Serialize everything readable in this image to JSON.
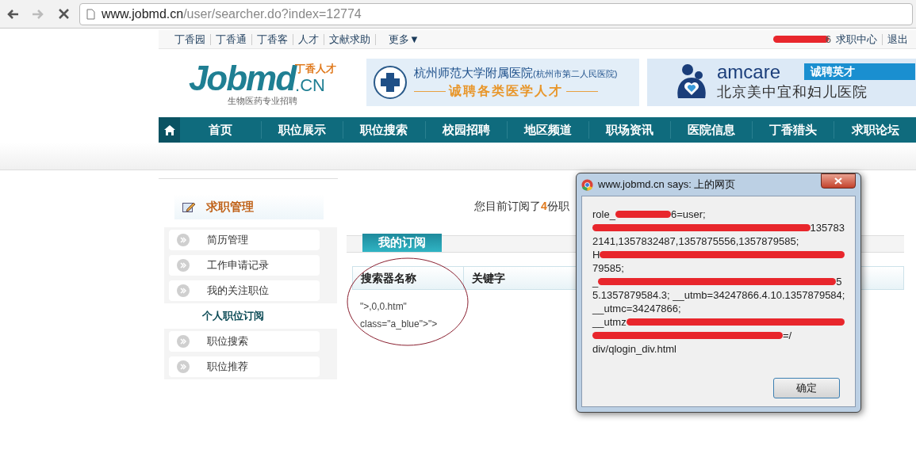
{
  "browser": {
    "back_disabled": false,
    "forward_disabled": true,
    "url_host": "www.jobmd.cn",
    "url_path": "/user/searcher.do?index=12774"
  },
  "top_links": [
    "丁香园",
    "丁香通",
    "丁香客",
    "人才",
    "文献求助"
  ],
  "more": "更多▼",
  "account": {
    "user_tail": "6",
    "links": [
      "求职中心",
      "退出"
    ]
  },
  "logo": {
    "name": "Jobmd",
    "tld": ".CN",
    "cn_name": "丁香人才",
    "slogan": "生物医药专业招聘"
  },
  "banners": [
    {
      "kind": "hospital",
      "title": "杭州师范大学附属医院",
      "subtitle": "(杭州市第二人民医院)",
      "tagline": "诚聘各类医学人才"
    },
    {
      "kind": "amcare",
      "brand": "amcare",
      "badge": "诚聘英才",
      "title": "北京美中宜和妇儿医院"
    }
  ],
  "nav": [
    {
      "label": "首页",
      "selected": false
    },
    {
      "label": "职位展示",
      "selected": false
    },
    {
      "label": "职位搜索",
      "selected": false
    },
    {
      "label": "校园招聘",
      "selected": false
    },
    {
      "label": "地区频道",
      "selected": false
    },
    {
      "label": "职场资讯",
      "selected": false
    },
    {
      "label": "医院信息",
      "selected": false
    },
    {
      "label": "丁香猎头",
      "selected": false
    },
    {
      "label": "求职论坛",
      "selected": false
    }
  ],
  "home_selected": true,
  "sidebar": {
    "title": "求职管理",
    "items": [
      {
        "label": "简历管理",
        "selected": false
      },
      {
        "label": "工作申请记录",
        "selected": false
      },
      {
        "label": "我的关注职位",
        "selected": false
      },
      {
        "label": "个人职位订阅",
        "selected": true
      },
      {
        "label": "职位搜索",
        "selected": false
      },
      {
        "label": "职位推荐",
        "selected": false
      }
    ]
  },
  "summary": {
    "prefix": "您目前订阅了",
    "count": "4",
    "suffix": "份职"
  },
  "tab": "我的订阅",
  "table": {
    "columns": [
      "搜索器名称",
      "关键字"
    ],
    "rows": [
      [
        "\">,0,0.htm\" class=\"a_blue\">\">"
      ]
    ]
  },
  "dialog": {
    "title": "www.jobmd.cn says: 上的网页",
    "lines": [
      [
        {
          "kind": "text",
          "text": "role_"
        },
        {
          "kind": "redaction"
        },
        {
          "kind": "text",
          "text": "6=user;"
        }
      ],
      [
        {
          "kind": "redaction"
        },
        {
          "kind": "text",
          "text": "135783"
        }
      ],
      [
        {
          "kind": "text",
          "text": "2141,1357832487,1357875556,1357879585;"
        }
      ],
      [
        {
          "kind": "text",
          "text": "H"
        },
        {
          "kind": "redaction"
        }
      ],
      [
        {
          "kind": "text",
          "text": "79585;"
        }
      ],
      [
        {
          "kind": "text",
          "text": "_"
        },
        {
          "kind": "redaction"
        },
        {
          "kind": "text",
          "text": "5"
        }
      ],
      [
        {
          "kind": "text",
          "text": "5.1357879584.3; __utmb=34247866.4.10.1357879584;"
        }
      ],
      [
        {
          "kind": "text",
          "text": "__utmc=34247866;"
        }
      ],
      [
        {
          "kind": "text",
          "text": "__utmz"
        },
        {
          "kind": "redaction"
        }
      ],
      [
        {
          "kind": "redaction"
        },
        {
          "kind": "text",
          "text": "=/"
        }
      ],
      [
        {
          "kind": "text",
          "text": "div/qlogin_div.html"
        }
      ]
    ],
    "ok": "确定"
  }
}
